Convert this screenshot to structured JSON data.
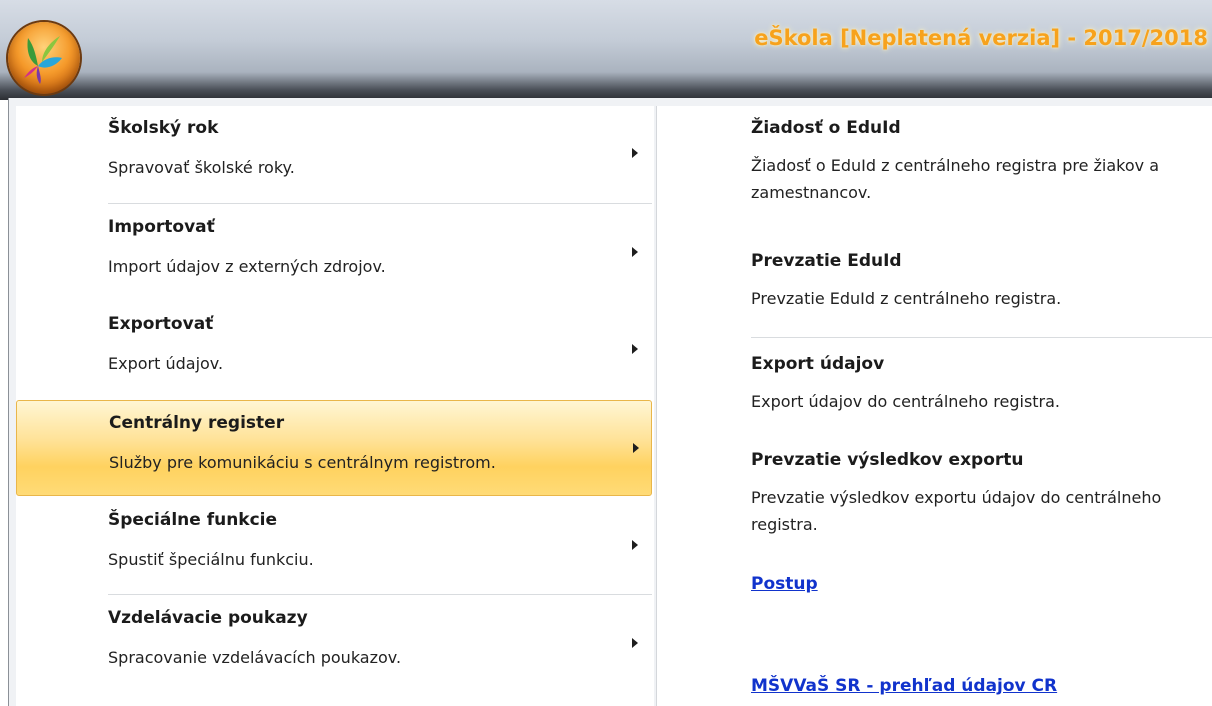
{
  "window": {
    "title": "eŠkola [Neplatená verzia] - 2017/2018"
  },
  "app_icon": {
    "name": "app-orb-icon"
  },
  "menu": {
    "items": [
      {
        "title": "Školský rok",
        "description": "Spravovať školské roky."
      },
      {
        "title": "Importovať",
        "description": "Import údajov z externých zdrojov."
      },
      {
        "title": "Exportovať",
        "description": "Export údajov."
      },
      {
        "title": "Centrálny register",
        "description": "Služby pre komunikáciu s centrálnym registrom."
      },
      {
        "title": "Špeciálne funkcie",
        "description": "Spustiť špeciálnu funkciu."
      },
      {
        "title": "Vzdelávacie poukazy",
        "description": "Spracovanie vzdelávacích poukazov."
      }
    ],
    "selected": "Centrálny register"
  },
  "submenu": {
    "items": [
      {
        "title": "Žiadosť o EduId",
        "description": "Žiadosť o EduId z centrálneho registra pre žiakov a zamestnancov."
      },
      {
        "title": "Prevzatie EduId",
        "description": "Prevzatie EduId z centrálneho registra."
      },
      {
        "title": "Export údajov",
        "description": "Export údajov do centrálneho registra."
      },
      {
        "title": "Prevzatie výsledkov exportu",
        "description": "Prevzatie výsledkov exportu údajov do centrálneho registra."
      }
    ],
    "links": [
      {
        "label": "Postup"
      },
      {
        "label": "MŠVVaŠ SR - prehľad údajov CR"
      }
    ]
  },
  "colors": {
    "highlight": "#ffd25f",
    "title_text": "#f7a21c",
    "link": "#1133cc"
  }
}
